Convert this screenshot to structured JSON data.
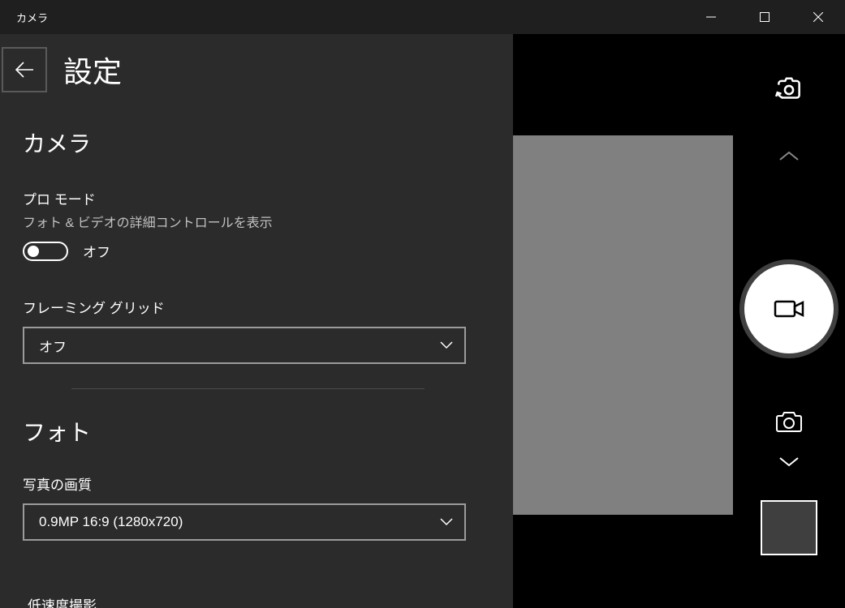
{
  "window": {
    "title": "カメラ"
  },
  "settings": {
    "title": "設定",
    "sections": {
      "camera": {
        "heading": "カメラ",
        "pro_mode": {
          "label": "プロ モード",
          "sublabel": "フォト & ビデオの詳細コントロールを表示",
          "state": "オフ"
        },
        "framing_grid": {
          "label": "フレーミング グリッド",
          "value": "オフ"
        }
      },
      "photo": {
        "heading": "フォト",
        "quality": {
          "label": "写真の画質",
          "value": "0.9MP 16:9 (1280x720)"
        },
        "truncated_label": "低速度撮影"
      }
    }
  },
  "icons": {
    "switch_camera": "switch-camera-icon",
    "chevron_up": "chevron-up-icon",
    "video": "video-icon",
    "camera": "camera-icon",
    "chevron_down": "chevron-down-icon",
    "back": "back-arrow-icon",
    "minimize": "minimize-icon",
    "maximize": "maximize-icon",
    "close": "close-icon"
  }
}
